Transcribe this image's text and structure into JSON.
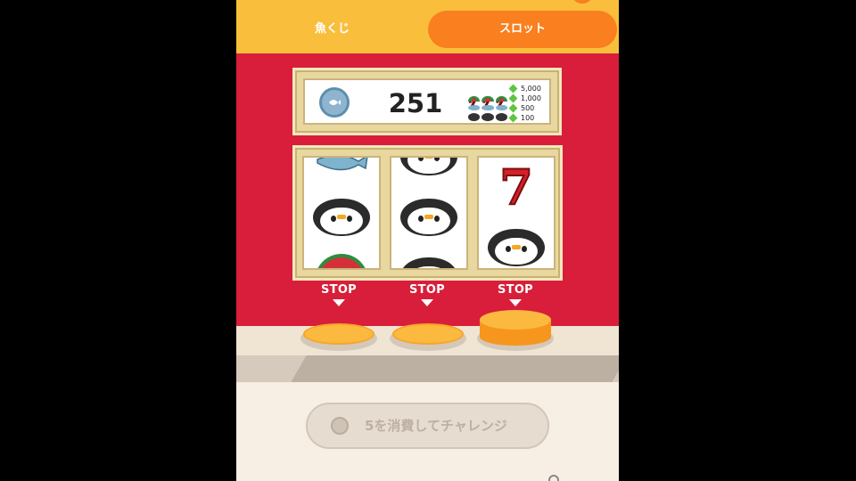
{
  "tabs": {
    "fish_lottery": "魚くじ",
    "slot": "スロット"
  },
  "credit": "251",
  "paytable": [
    {
      "symbol": "seven-icon",
      "value": "5,000"
    },
    {
      "symbol": "watermelon-icon",
      "value": "1,000"
    },
    {
      "symbol": "fish-icon",
      "value": "500"
    },
    {
      "symbol": "penguin-icon",
      "value": "100"
    }
  ],
  "reels": [
    [
      "fish",
      "penguin",
      "watermelon"
    ],
    [
      "penguin",
      "penguin",
      "penguin"
    ],
    [
      "seven",
      "penguin"
    ]
  ],
  "stop_label": "STOP",
  "challenge_button": "5を消費してチャレンジ",
  "colors": {
    "tab_bar": "#f9bf3c",
    "active_tab": "#f97f1f",
    "stage": "#d81e3a",
    "stop_button": "#fcb940"
  }
}
